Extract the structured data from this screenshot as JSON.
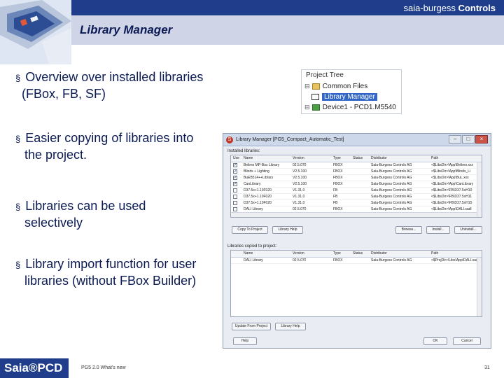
{
  "header": {
    "brand_regular": "saia-burgess ",
    "brand_bold": "Controls",
    "title": "Library Manager"
  },
  "bullets": [
    {
      "marker": "§",
      "lines": [
        "Overview over installed libraries",
        "(FBox, FB, SF)"
      ]
    },
    {
      "marker": "§",
      "lines": [
        "Easier copying of libraries into",
        "the project."
      ]
    },
    {
      "marker": "§",
      "lines": [
        "Libraries can be used",
        "selectively"
      ]
    },
    {
      "marker": "§",
      "lines": [
        "Library import function for user",
        "libraries (without FBox Builder)"
      ]
    }
  ],
  "project_tree": {
    "title": "Project Tree",
    "items": [
      {
        "label": "Common Files",
        "expander": "⊟",
        "icon": "folder-icon",
        "selected": false
      },
      {
        "label": "Library Manager",
        "expander": "",
        "icon": "library-icon",
        "selected": true
      },
      {
        "label": "Device1 - PCD1.M5540",
        "expander": "⊟",
        "icon": "device-icon",
        "selected": false
      }
    ]
  },
  "library_manager": {
    "window_title": "Library Manager [PG5_Compact_Automatic_Test]",
    "installed_label": "Installed libraries:",
    "columns": [
      "Use",
      "Name",
      "Version",
      "Type",
      "Status",
      "Distributor",
      "Path"
    ],
    "installed_rows": [
      {
        "checked": true,
        "name": "Belimo MP-Bus Library",
        "version": "02.5.070",
        "type": "FBOX",
        "status": "",
        "distributor": "Saia-Burgess Controls AG",
        "path": "<$LibsDir>\\App\\Belimo.xxx"
      },
      {
        "checked": true,
        "name": "Blinds + Lighting",
        "version": "V2.5.100",
        "type": "FBOX",
        "status": "",
        "distributor": "Saia-Burgess Controls AG",
        "path": "<$LibsDir>\\App\\Blinds_Li"
      },
      {
        "checked": true,
        "name": "BuEB514++Library",
        "version": "V2.5.100",
        "type": "FBOX",
        "status": "",
        "distributor": "Saia-Burgess Controls AG",
        "path": "<$LibsDir>\\App\\BuL.xxx"
      },
      {
        "checked": true,
        "name": "CanLibrary",
        "version": "V2.5.100",
        "type": "FBOX",
        "status": "",
        "distributor": "Saia-Burgess Controls AG",
        "path": "<$LibsDir>\\App\\CanLibrary"
      },
      {
        "checked": false,
        "name": "D37.5x+1.10F020",
        "version": "V1.31.0",
        "type": "FB",
        "status": "",
        "distributor": "Saia-Burgess Controls AG",
        "path": "<$LibsDir>\\FB\\D37.5xH10"
      },
      {
        "checked": false,
        "name": "D37.5x+1.10F020",
        "version": "V1.31.0",
        "type": "FB",
        "status": "",
        "distributor": "Saia-Burgess Controls AG",
        "path": "<$LibsDir>\\FB\\D37.5xH11"
      },
      {
        "checked": false,
        "name": "D37.5x+1.10F020",
        "version": "V1.31.0",
        "type": "FB",
        "status": "",
        "distributor": "Saia-Burgess Controls AG",
        "path": "<$LibsDir>\\FB\\D37.5xH15"
      },
      {
        "checked": false,
        "name": "DALI Library",
        "version": "02.5.070",
        "type": "FBOX",
        "status": "",
        "distributor": "Saia-Burgess Controls AG",
        "path": "<$LibsDir>\\App\\DALI.sadl"
      }
    ],
    "buttons_top": {
      "copy": "Copy To Project",
      "help": "Library Help",
      "browse": "Browse...",
      "install": "Install...",
      "uninstall": "Uninstall..."
    },
    "copied_label": "Libraries copied to project:",
    "copied_rows": [
      {
        "name": "DALI Library",
        "version": "02.5.070",
        "type": "FBOX",
        "status": "",
        "distributor": "Saia-Burgess Controls AG",
        "path": "<$ProjDir>\\Libs\\App\\DALI.sad"
      }
    ],
    "buttons_bottom": {
      "update": "Update From Project",
      "help": "Library Help"
    },
    "footer_buttons": {
      "help": "Help",
      "ok": "OK",
      "cancel": "Cancel"
    }
  },
  "footer": {
    "logo": "Saia®PCD",
    "text": "PG5 2.0 What's new",
    "page": "31"
  }
}
